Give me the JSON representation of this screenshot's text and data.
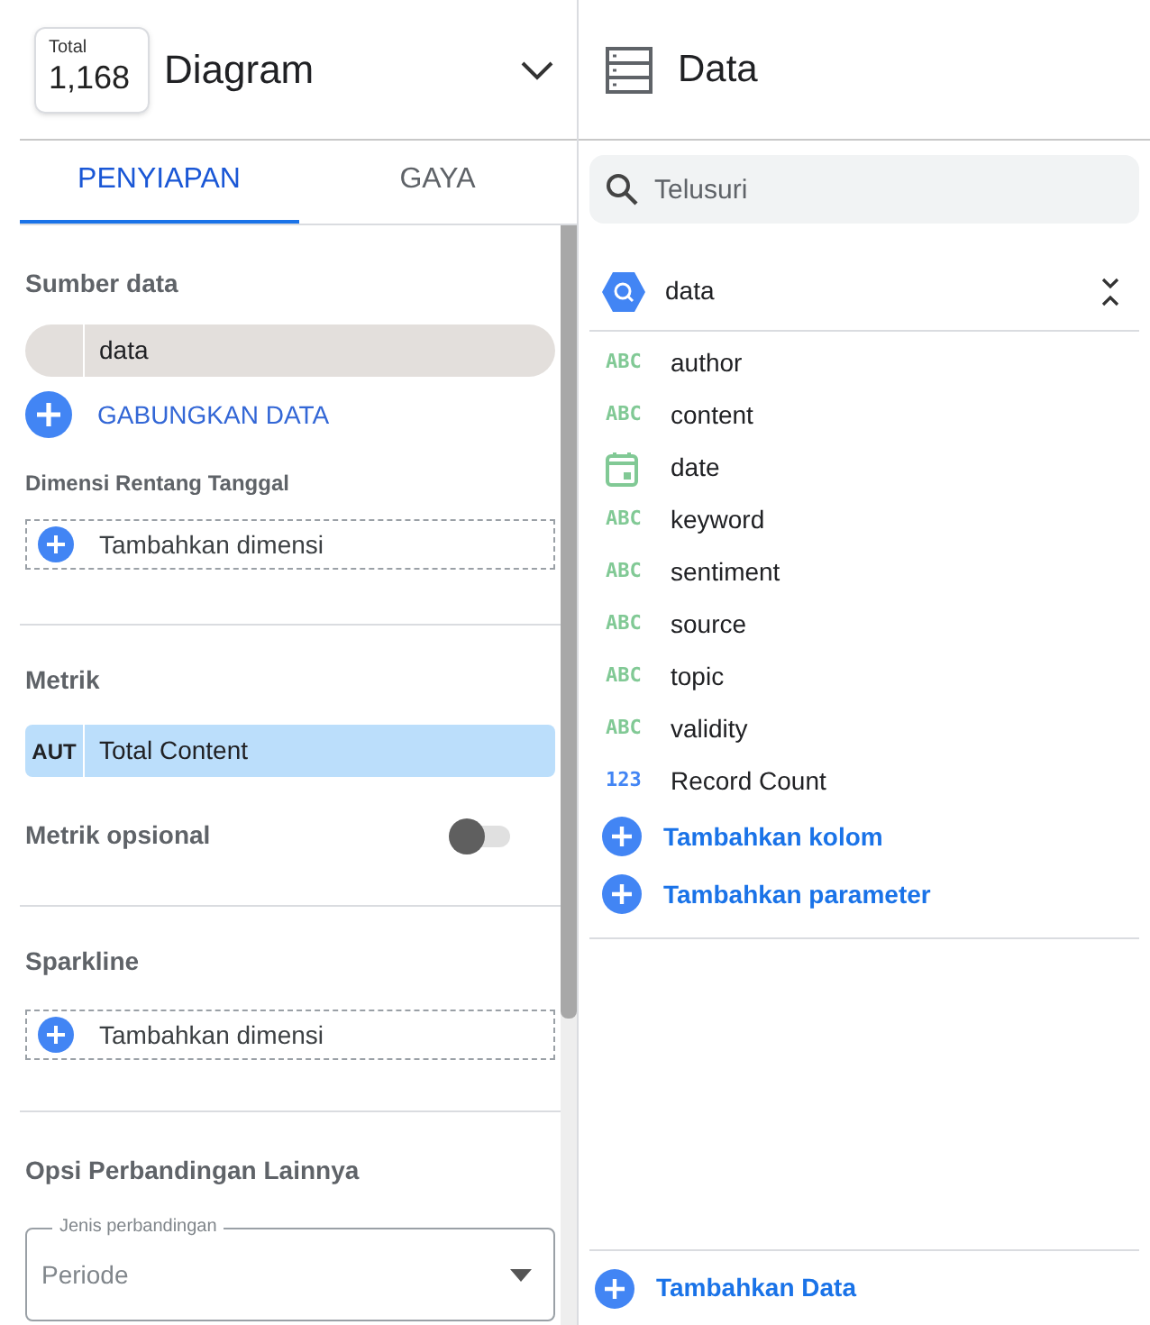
{
  "chart_header": {
    "scorecard_label": "Total",
    "scorecard_value": "1,168",
    "title": "Diagram"
  },
  "tabs": [
    {
      "label": "PENYIAPAN",
      "selected": true
    },
    {
      "label": "GAYA",
      "selected": false
    }
  ],
  "setup": {
    "data_source": {
      "title": "Sumber data",
      "source": "data",
      "blend_label": "GABUNGKAN DATA"
    },
    "date_range": {
      "title": "Dimensi Rentang Tanggal",
      "add_label": "Tambahkan dimensi"
    },
    "metric": {
      "title": "Metrik",
      "chip_label": "AUT",
      "chip_value": "Total Content"
    },
    "optional_metric": {
      "label": "Metrik opsional",
      "on": false
    },
    "sparkline": {
      "title": "Sparkline",
      "add_label": "Tambahkan dimensi"
    },
    "comparison": {
      "title": "Opsi Perbandingan Lainnya",
      "field_label": "Jenis perbandingan",
      "value": "Periode"
    }
  },
  "data_panel": {
    "title": "Data",
    "search_placeholder": "Telusuri",
    "source": "data",
    "fields": [
      {
        "kind": "text",
        "type_label": "ABC",
        "name": "author"
      },
      {
        "kind": "text",
        "type_label": "ABC",
        "name": "content"
      },
      {
        "kind": "date",
        "name": "date"
      },
      {
        "kind": "text",
        "type_label": "ABC",
        "name": "keyword"
      },
      {
        "kind": "text",
        "type_label": "ABC",
        "name": "sentiment"
      },
      {
        "kind": "text",
        "type_label": "ABC",
        "name": "source"
      },
      {
        "kind": "text",
        "type_label": "ABC",
        "name": "topic"
      },
      {
        "kind": "text",
        "type_label": "ABC",
        "name": "validity"
      },
      {
        "kind": "number",
        "type_label": "123",
        "name": "Record Count"
      }
    ],
    "actions": [
      "Tambahkan kolom",
      "Tambahkan parameter"
    ],
    "add_data": "Tambahkan Data"
  }
}
